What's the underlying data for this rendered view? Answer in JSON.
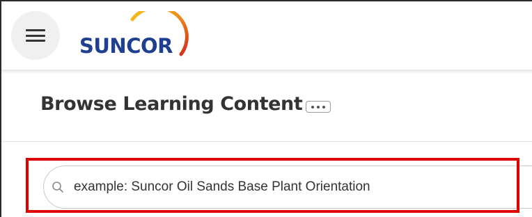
{
  "header": {
    "menu_icon": "hamburger-menu-icon",
    "logo": {
      "text": "SUNCOR",
      "accent_colors": [
        "#f5b400",
        "#e8701a",
        "#d3291d"
      ],
      "text_color": "#1f3f8f"
    }
  },
  "page": {
    "title": "Browse Learning Content",
    "more_icon": "ellipsis-icon"
  },
  "search": {
    "icon": "search-icon",
    "placeholder": "example: Suncor Oil Sands Base Plant Orientation",
    "value": ""
  },
  "annotation": {
    "color": "#e00000"
  }
}
